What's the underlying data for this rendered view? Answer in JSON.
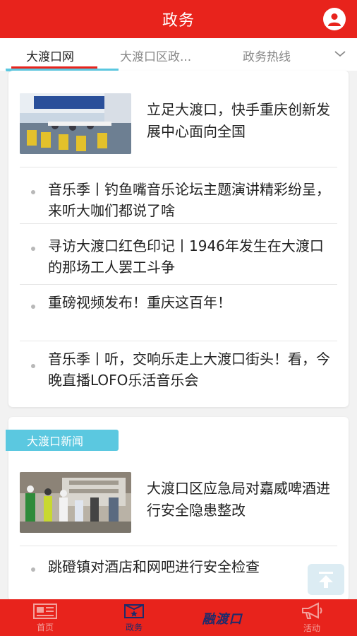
{
  "header": {
    "title": "政务"
  },
  "tabs": [
    {
      "label": "大渡口网"
    },
    {
      "label": "大渡口区政..."
    },
    {
      "label": "政务热线"
    }
  ],
  "card1": {
    "feature_title": "立足大渡口，快手重庆创新发展中心面向全国",
    "items": [
      "音乐季丨钓鱼嘴音乐论坛主题演讲精彩纷呈，来听大咖们都说了啥",
      "寻访大渡口红色印记丨1946年发生在大渡口的那场工人罢工斗争",
      "重磅视频发布！重庆这百年！",
      "音乐季丨听，交响乐走上大渡口街头！看，今晚直播LOFO乐活音乐会"
    ]
  },
  "card2": {
    "section_label": "大渡口新闻",
    "feature_title": "大渡口区应急局对嘉威啤酒进行安全隐患整改",
    "items": [
      "跳磴镇对酒店和网吧进行安全检查"
    ]
  },
  "bottom_nav": {
    "items": [
      {
        "label": "首页"
      },
      {
        "label": "政务"
      },
      {
        "label": "活动"
      }
    ],
    "logo_text": "融渡口"
  },
  "colors": {
    "brand_red": "#e8231c",
    "accent_cyan": "#5bc8e0",
    "nav_active": "#1d2b6b"
  }
}
